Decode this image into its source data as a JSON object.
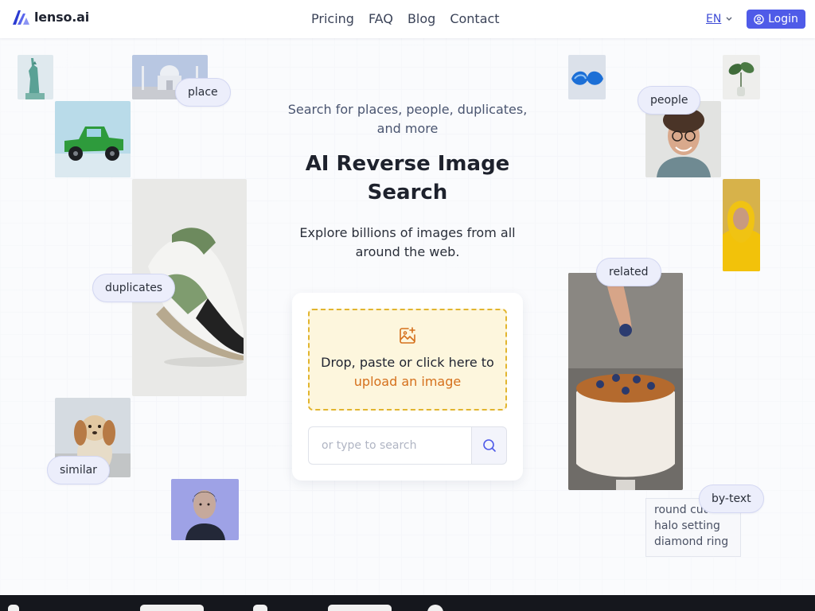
{
  "header": {
    "logo_text": "lenso.ai",
    "nav": [
      "Pricing",
      "FAQ",
      "Blog",
      "Contact"
    ],
    "language": "EN",
    "login_label": "Login"
  },
  "hero": {
    "tagline": "Search for places, people, duplicates, and more",
    "title": "AI Reverse Image Search",
    "subtitle": "Explore billions of images from all around the web."
  },
  "upload": {
    "drop_text": "Drop, paste or click here to",
    "drop_link": "upload an image",
    "search_placeholder": "or type to search"
  },
  "categories": {
    "place": "place",
    "duplicates": "duplicates",
    "similar": "similar",
    "people": "people",
    "related": "related",
    "by_text": "by-text"
  },
  "by_text_example": [
    "round cut",
    "halo setting",
    "diamond ring"
  ],
  "icons": {
    "logo": "lenso-logo-icon",
    "chevron": "chevron-down-icon",
    "login": "user-circle-icon",
    "upload": "image-plus-icon",
    "search": "search-icon"
  },
  "colors": {
    "accent": "#4f5be8",
    "dropzone_bg": "#fdf6dd",
    "dropzone_border": "#e2b52f",
    "link": "#d5701c",
    "footer": "#15171d"
  }
}
